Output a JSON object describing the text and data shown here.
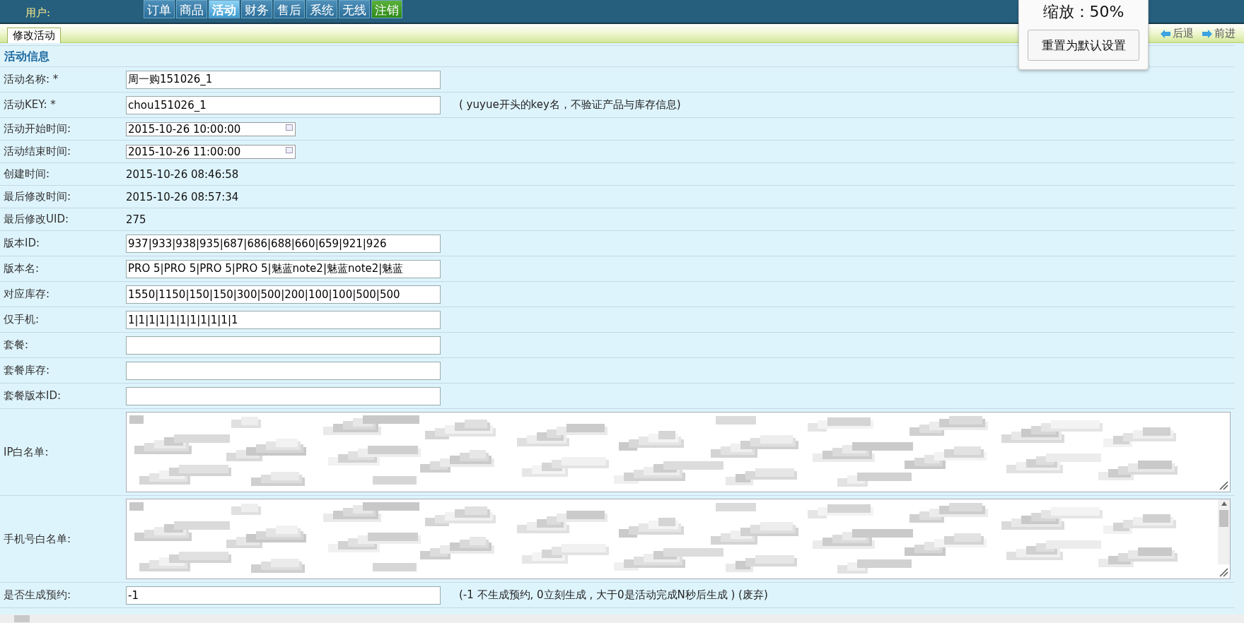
{
  "top_bar": {
    "user_label": "用户:",
    "nav": [
      {
        "label": "订单",
        "selected": false,
        "kind": "normal"
      },
      {
        "label": "商品",
        "selected": false,
        "kind": "normal"
      },
      {
        "label": "活动",
        "selected": true,
        "kind": "normal"
      },
      {
        "label": "财务",
        "selected": false,
        "kind": "normal"
      },
      {
        "label": "售后",
        "selected": false,
        "kind": "normal"
      },
      {
        "label": "系统",
        "selected": false,
        "kind": "normal"
      },
      {
        "label": "无线",
        "selected": false,
        "kind": "normal"
      },
      {
        "label": "注销",
        "selected": false,
        "kind": "logout"
      }
    ]
  },
  "page_tabs": [
    {
      "label": "修改活动",
      "selected": true
    }
  ],
  "history_links": [
    {
      "label": "后退",
      "kind": "back"
    },
    {
      "label": "前进",
      "kind": "forward"
    }
  ],
  "zoom_popup": {
    "title": "缩放：50%",
    "button": "重置为默认设置"
  },
  "section_title": "活动信息",
  "fields": [
    {
      "label": "活动名称: *",
      "kind": "input",
      "value": "周一购151026_1"
    },
    {
      "label": "活动KEY: *",
      "kind": "input",
      "value": "chou151026_1",
      "note": "( yuyue开头的key名，不验证产品与库存信息)"
    },
    {
      "label": "活动开始时间:",
      "kind": "date",
      "value": "2015-10-26 10:00:00"
    },
    {
      "label": "活动结束时间:",
      "kind": "date",
      "value": "2015-10-26 11:00:00"
    },
    {
      "label": "创建时间:",
      "kind": "text",
      "value": "2015-10-26 08:46:58"
    },
    {
      "label": "最后修改时间:",
      "kind": "text",
      "value": "2015-10-26 08:57:34"
    },
    {
      "label": "最后修改UID:",
      "kind": "text",
      "value": "275"
    },
    {
      "label": "版本ID:",
      "kind": "input",
      "value": "937|933|938|935|687|686|688|660|659|921|926"
    },
    {
      "label": "版本名:",
      "kind": "input",
      "value": "PRO 5|PRO 5|PRO 5|PRO 5|魅蓝note2|魅蓝note2|魅蓝"
    },
    {
      "label": "对应库存:",
      "kind": "input",
      "value": "1550|1150|150|150|300|500|200|100|100|500|500"
    },
    {
      "label": "仅手机:",
      "kind": "input",
      "value": "1|1|1|1|1|1|1|1|1|1|1"
    },
    {
      "label": "套餐:",
      "kind": "input"
    },
    {
      "label": "套餐库存:",
      "kind": "input"
    },
    {
      "label": "套餐版本ID:",
      "kind": "input"
    },
    {
      "label": "IP白名单:",
      "kind": "textarea",
      "scrollbar": false
    },
    {
      "label": "手机号白名单:",
      "kind": "textarea",
      "scrollbar": true
    },
    {
      "label": "是否生成预约:",
      "kind": "input",
      "value": "-1",
      "note": "(-1 不生成预约, 0立刻生成 , 大于0是活动完成N秒后生成 ) (废弃)"
    }
  ]
}
